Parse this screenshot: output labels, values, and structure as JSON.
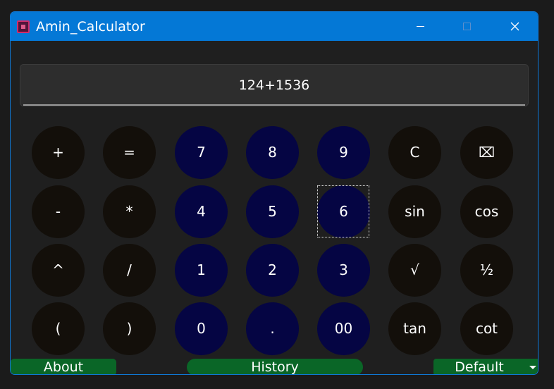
{
  "window": {
    "title": "Amin_Calculator",
    "accent": "#0478d6"
  },
  "display": {
    "value": "124+1536"
  },
  "keys": [
    [
      {
        "label": "+",
        "kind": "op"
      },
      {
        "label": "=",
        "kind": "op"
      },
      {
        "label": "7",
        "kind": "num"
      },
      {
        "label": "8",
        "kind": "num"
      },
      {
        "label": "9",
        "kind": "num"
      },
      {
        "label": "C",
        "kind": "op"
      },
      {
        "label": "⌧",
        "kind": "op"
      }
    ],
    [
      {
        "label": "-",
        "kind": "op"
      },
      {
        "label": "*",
        "kind": "op"
      },
      {
        "label": "4",
        "kind": "num"
      },
      {
        "label": "5",
        "kind": "num"
      },
      {
        "label": "6",
        "kind": "num"
      },
      {
        "label": "sin",
        "kind": "op"
      },
      {
        "label": "cos",
        "kind": "op"
      }
    ],
    [
      {
        "label": "^",
        "kind": "op"
      },
      {
        "label": "/",
        "kind": "op"
      },
      {
        "label": "1",
        "kind": "num"
      },
      {
        "label": "2",
        "kind": "num"
      },
      {
        "label": "3",
        "kind": "num"
      },
      {
        "label": "√",
        "kind": "op"
      },
      {
        "label": "½",
        "kind": "op"
      }
    ],
    [
      {
        "label": "(",
        "kind": "op"
      },
      {
        "label": ")",
        "kind": "op"
      },
      {
        "label": "0",
        "kind": "num"
      },
      {
        "label": ".",
        "kind": "num"
      },
      {
        "label": "00",
        "kind": "num"
      },
      {
        "label": "tan",
        "kind": "op"
      },
      {
        "label": "cot",
        "kind": "op"
      }
    ]
  ],
  "focused_key": "6",
  "bottom": {
    "about_label": "About",
    "history_label": "History",
    "mode_selected": "Default"
  },
  "colors": {
    "number_key": "#050543",
    "operator_key": "#130f0a",
    "bottom_button": "#0a6627"
  }
}
